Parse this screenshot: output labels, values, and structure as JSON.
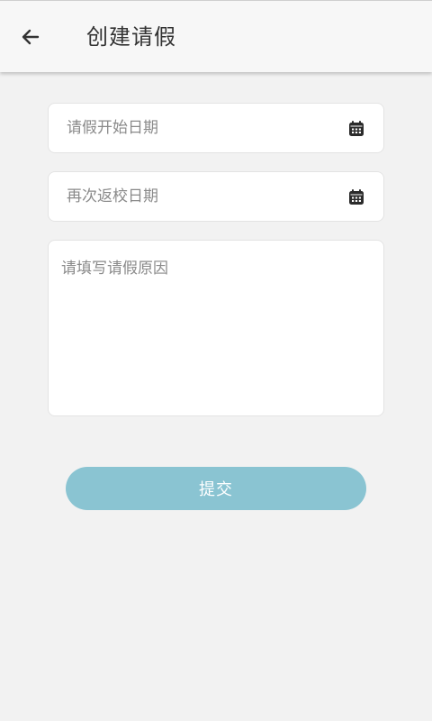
{
  "header": {
    "back_icon": "arrow-left-icon",
    "title": "创建请假"
  },
  "form": {
    "start_date": {
      "placeholder": "请假开始日期",
      "icon": "calendar-icon"
    },
    "return_date": {
      "placeholder": "再次返校日期",
      "icon": "calendar-icon"
    },
    "reason": {
      "placeholder": "请填写请假原因"
    },
    "submit_label": "提交"
  },
  "colors": {
    "background": "#f2f2f2",
    "header_background": "#f7f7f7",
    "submit_button": "#8ac4d2",
    "placeholder_text": "#8a8a8a"
  }
}
